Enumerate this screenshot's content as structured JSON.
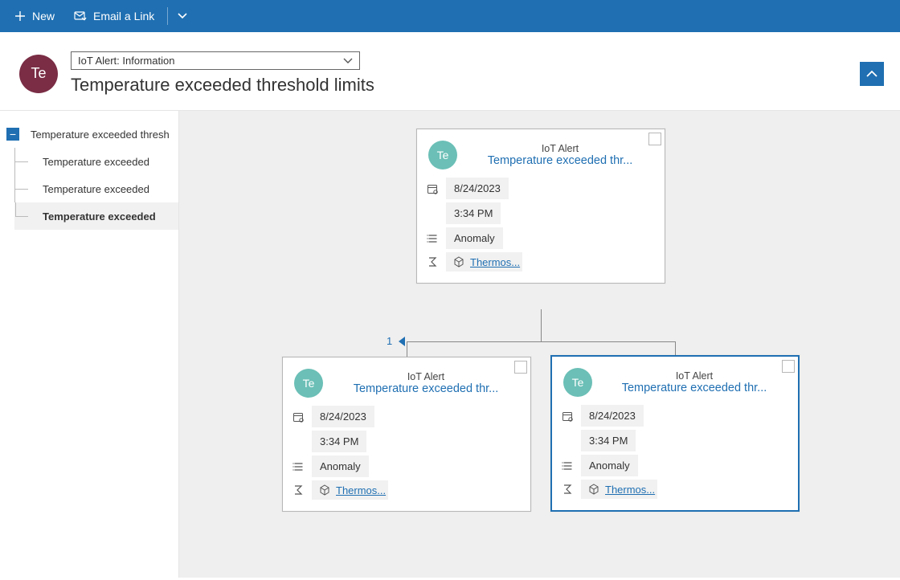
{
  "commands": {
    "new_label": "New",
    "email_link_label": "Email a Link"
  },
  "header": {
    "avatar_initials": "Te",
    "form_selector": "IoT Alert: Information",
    "title": "Temperature exceeded threshold limits"
  },
  "tree": {
    "root": {
      "label": "Temperature exceeded thresh"
    },
    "children": [
      {
        "label": "Temperature exceeded"
      },
      {
        "label": "Temperature exceeded"
      },
      {
        "label": "Temperature exceeded",
        "selected": true
      }
    ]
  },
  "pager": {
    "count": "1"
  },
  "cards": {
    "parent": {
      "avatar": "Te",
      "type": "IoT Alert",
      "title": "Temperature exceeded thr...",
      "date": "8/24/2023",
      "time": "3:34 PM",
      "category": "Anomaly",
      "device": "Thermos..."
    },
    "child_a": {
      "avatar": "Te",
      "type": "IoT Alert",
      "title": "Temperature exceeded thr...",
      "date": "8/24/2023",
      "time": "3:34 PM",
      "category": "Anomaly",
      "device": "Thermos..."
    },
    "child_b": {
      "avatar": "Te",
      "type": "IoT Alert",
      "title": "Temperature exceeded thr...",
      "date": "8/24/2023",
      "time": "3:34 PM",
      "category": "Anomaly",
      "device": "Thermos..."
    }
  }
}
